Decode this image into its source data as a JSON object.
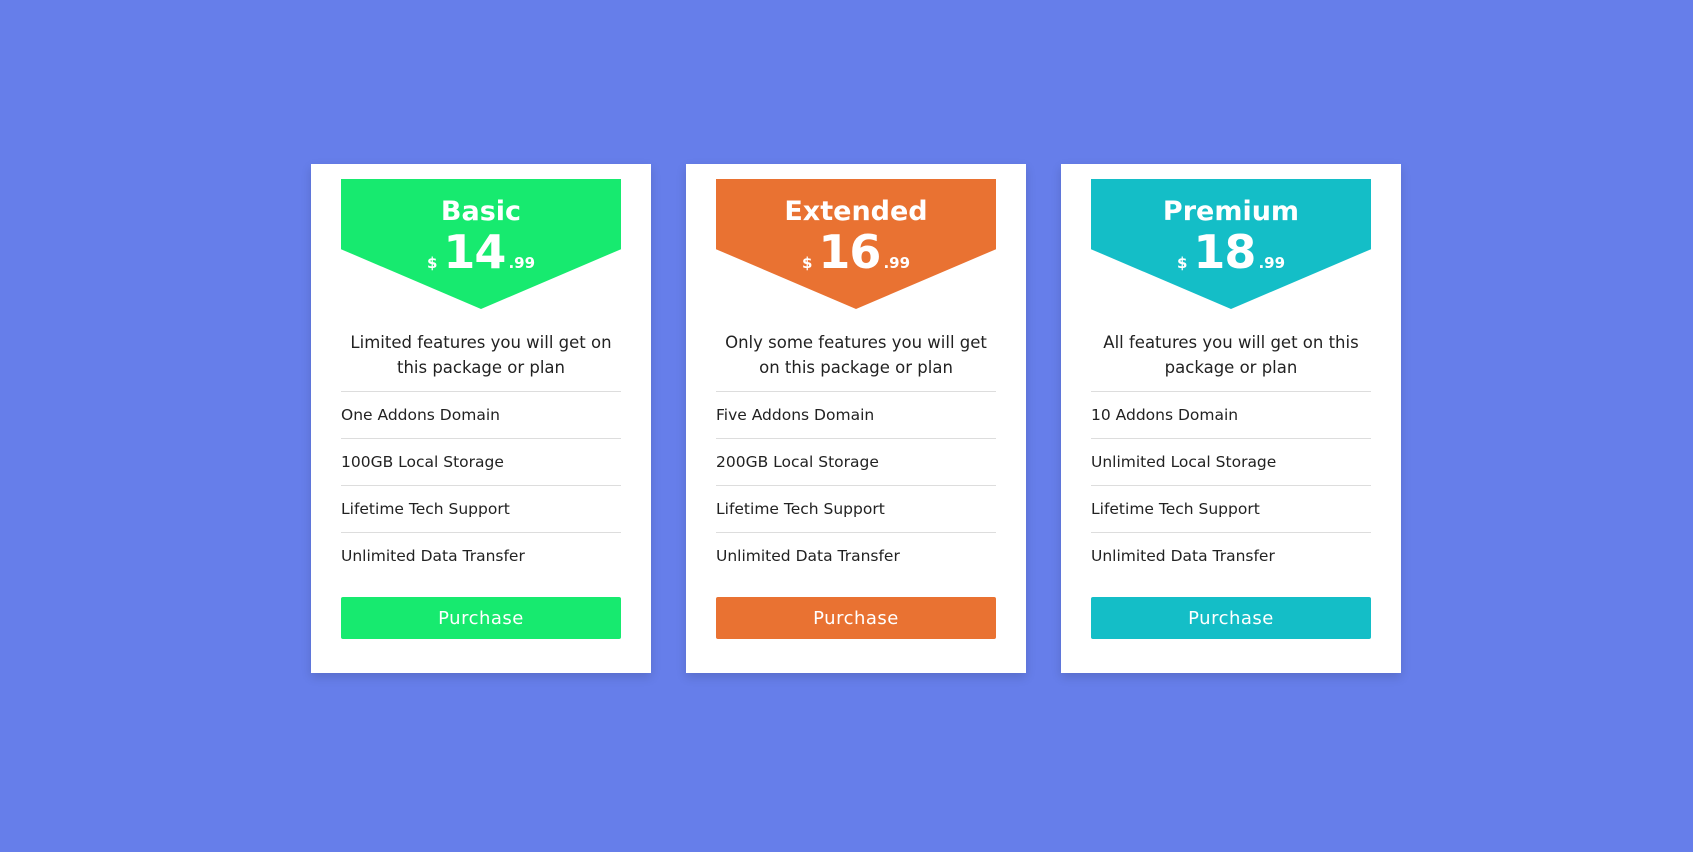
{
  "plans": [
    {
      "name": "Basic",
      "currency": "$",
      "price": "14",
      "cents": ".99",
      "description": "Limited features you will get on this package or plan",
      "features": [
        "One Addons Domain",
        "100GB Local Storage",
        "Lifetime Tech Support",
        "Unlimited Data Transfer"
      ],
      "button": "Purchase",
      "color": "#17ea6f"
    },
    {
      "name": "Extended",
      "currency": "$",
      "price": "16",
      "cents": ".99",
      "description": "Only some features you will get on this package or plan",
      "features": [
        "Five Addons Domain",
        "200GB Local Storage",
        "Lifetime Tech Support",
        "Unlimited Data Transfer"
      ],
      "button": "Purchase",
      "color": "#e97232"
    },
    {
      "name": "Premium",
      "currency": "$",
      "price": "18",
      "cents": ".99",
      "description": "All features you will get on this package or plan",
      "features": [
        "10 Addons Domain",
        "Unlimited Local Storage",
        "Lifetime Tech Support",
        "Unlimited Data Transfer"
      ],
      "button": "Purchase",
      "color": "#14bec7"
    }
  ],
  "background_color": "#667eea"
}
